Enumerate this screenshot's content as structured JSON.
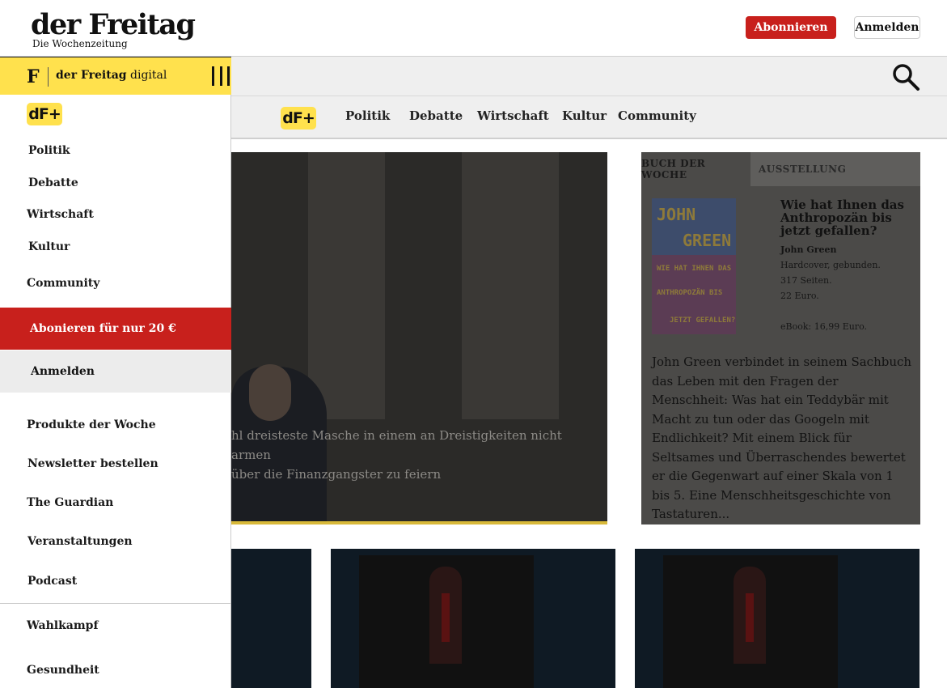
{
  "header": {
    "logo_main": "der Freitag",
    "logo_sub": "Die Wochenzeitung",
    "subscribe_label": "Abonnieren",
    "login_label": "Anmelden"
  },
  "search": {
    "icon": "search-icon"
  },
  "nav": {
    "badge": "dF+",
    "items": [
      "Politik",
      "Debatte",
      "Wirtschaft",
      "Kultur",
      "Community"
    ]
  },
  "hero": {
    "line1": "hl dreisteste Masche in einem an Dreistigkeiten nicht armen",
    "line2": "über die Finanzgangster zu feiern"
  },
  "sidebox": {
    "tab_active": "BUCH DER WOCHE",
    "tab_inactive": "AUSSTELLUNG",
    "cover_lines": [
      "JOHN",
      "GREEN",
      "WIE HAT IHNEN DAS",
      "ANTHROPOZÄN BIS",
      "JETZT GEFALLEN?"
    ],
    "title": "Wie hat Ihnen das Anthropozän bis jetzt gefallen?",
    "author": "John Green",
    "format": "Hardcover, gebunden.",
    "pages": "317 Seiten.",
    "price": "22 Euro.",
    "ebook": "eBook: 16,99 Euro.",
    "description": "John Green verbindet in seinem Sachbuch das Leben mit den Fragen der Menschheit: Was hat ein Teddybär mit Macht zu tun oder das Googeln mit Endlichkeit? Mit einem Blick für Seltsames und Überraschendes bewertet er die Gegenwart auf einer Skala von 1 bis 5. Eine Menschheitsgeschichte von Tastaturen..."
  },
  "menu": {
    "brand_bold": "der Freitag",
    "brand_rest": "digital",
    "badge": "dF+",
    "items": [
      "Politik",
      "Debatte",
      "Wirtschaft",
      "Kultur",
      "Community"
    ],
    "cta": "Abonieren für nur 20 €",
    "login": "Anmelden",
    "secondary": [
      "Produkte der Woche",
      "Newsletter bestellen",
      "The Guardian",
      "Veranstaltungen",
      "Podcast"
    ],
    "topics": [
      "Wahlkampf",
      "Gesundheit"
    ]
  },
  "colors": {
    "accent_red": "#c8201c",
    "accent_yellow": "#ffe14d"
  }
}
